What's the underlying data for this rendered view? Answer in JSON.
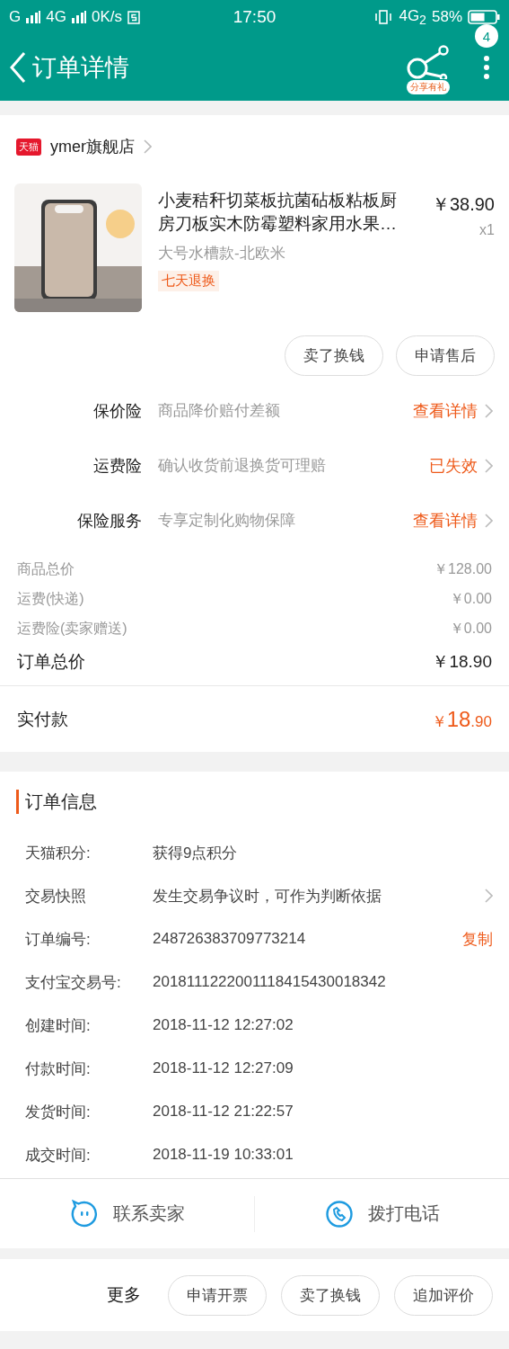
{
  "status_bar": {
    "network_1": "G",
    "network_2": "4G",
    "speed": "0K/s",
    "time": "17:50",
    "network_3": "4G$_{2}$",
    "battery": "58%"
  },
  "header": {
    "title": "订单详情",
    "share_label": "分享有礼",
    "badge": "4"
  },
  "store": {
    "badge": "天猫",
    "name": "ymer旗舰店"
  },
  "product": {
    "title": "小麦秸秆切菜板抗菌砧板粘板厨房刀板实木防霉塑料家用水果…",
    "variant": "大号水槽款-北欧米",
    "tag": "七天退换",
    "price": "￥38.90",
    "quantity": "x1"
  },
  "product_actions": [
    "卖了换钱",
    "申请售后"
  ],
  "services": [
    {
      "label": "保价险",
      "description": "商品降价赔付差额",
      "action": "查看详情"
    },
    {
      "label": "运费险",
      "description": "确认收货前退换货可理赔",
      "action": "已失效"
    },
    {
      "label": "保险服务",
      "description": "专享定制化购物保障",
      "action": "查看详情"
    }
  ],
  "costs": [
    {
      "kind": "sub",
      "label": "商品总价",
      "value": "￥128.00"
    },
    {
      "kind": "sub",
      "label": "运费(快递)",
      "value": "￥0.00"
    },
    {
      "kind": "sub",
      "label": "运费险(卖家赠送)",
      "value": "￥0.00"
    },
    {
      "kind": "total",
      "label": "订单总价",
      "value": "￥18.90"
    }
  ],
  "paid": {
    "label": "实付款",
    "currency": "￥",
    "integer": "18",
    "decimal": ".90"
  },
  "order_info": {
    "title": "订单信息",
    "rows": [
      {
        "kind": "plain",
        "label": "天猫积分:",
        "value": "获得9点积分"
      },
      {
        "kind": "chevron",
        "label": "交易快照",
        "value": "发生交易争议时，可作为判断依据"
      },
      {
        "kind": "copy",
        "label": "订单编号:",
        "value": "248726383709773214",
        "action": "复制"
      },
      {
        "kind": "plain",
        "label": "支付宝交易号:",
        "value": "2018111222001118415430018342"
      },
      {
        "kind": "plain",
        "label": "创建时间:",
        "value": "2018-11-12 12:27:02"
      },
      {
        "kind": "plain",
        "label": "付款时间:",
        "value": "2018-11-12 12:27:09"
      },
      {
        "kind": "plain",
        "label": "发货时间:",
        "value": "2018-11-12 21:22:57"
      },
      {
        "kind": "plain",
        "label": "成交时间:",
        "value": "2018-11-19 10:33:01"
      }
    ]
  },
  "contact": [
    {
      "kind": "chat",
      "label": "联系卖家"
    },
    {
      "kind": "phone",
      "label": "拨打电话"
    }
  ],
  "bottom_bar": {
    "more": "更多",
    "buttons": [
      "申请开票",
      "卖了换钱",
      "追加评价"
    ]
  }
}
